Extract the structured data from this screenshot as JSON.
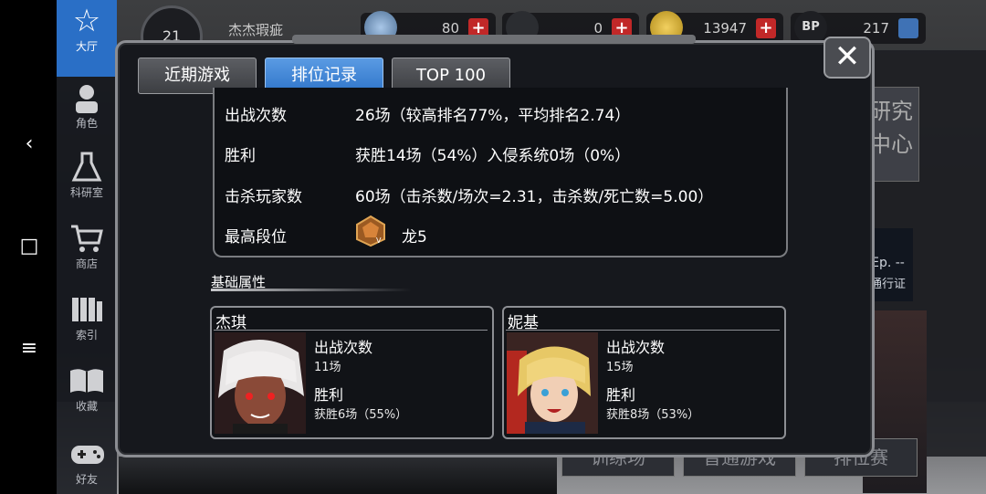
{
  "system_nav": {
    "back": "‹",
    "home": "□",
    "menu": "≡"
  },
  "sidebar": {
    "items": [
      {
        "label": "大厅",
        "icon": "hall-icon"
      },
      {
        "label": "角色",
        "icon": "character-icon"
      },
      {
        "label": "科研室",
        "icon": "flask-icon"
      },
      {
        "label": "商店",
        "icon": "cart-icon"
      },
      {
        "label": "索引",
        "icon": "books-icon"
      },
      {
        "label": "收藏",
        "icon": "open-book-icon"
      },
      {
        "label": "好友",
        "icon": "gamepad-icon"
      }
    ]
  },
  "topbar": {
    "level": "21",
    "player_name": "杰杰瑕疵",
    "resources": [
      {
        "icon": "feather-icon",
        "value": "80"
      },
      {
        "icon": "ticket-icon",
        "value": "0"
      },
      {
        "icon": "coin-icon",
        "value": "13947"
      },
      {
        "icon": "bp-icon",
        "value": "217",
        "bp_text": "BP"
      }
    ]
  },
  "background": {
    "research_label": "研究\n中心",
    "ep_label": "Ep. --",
    "pass_label": "通行证",
    "buttons": [
      "训练场",
      "普通游戏",
      "排位赛"
    ]
  },
  "modal": {
    "tabs": [
      "近期游戏",
      "排位记录",
      "TOP 100"
    ],
    "active_tab": 1,
    "stats": [
      {
        "label": "出战次数",
        "value": "26场（较高排名77%，平均排名2.74）"
      },
      {
        "label": "胜利",
        "value": "获胜14场（54%）入侵系统0场（0%）"
      },
      {
        "label": "击杀玩家数",
        "value": "60场（击杀数/场次=2.31，击杀数/死亡数=5.00）"
      },
      {
        "label": "最高段位",
        "value": "龙5"
      }
    ],
    "section_title": "基础属性",
    "characters": [
      {
        "name": "杰琪",
        "battles_label": "出战次数",
        "battles": "11场",
        "wins_label": "胜利",
        "wins": "获胜6场（55%）"
      },
      {
        "name": "妮基",
        "battles_label": "出战次数",
        "battles": "15场",
        "wins_label": "胜利",
        "wins": "获胜8场（53%）"
      }
    ]
  },
  "colors": {
    "accent_blue": "#2f74c9",
    "plus_red": "#c12828",
    "panel_border": "#8b8d92"
  }
}
